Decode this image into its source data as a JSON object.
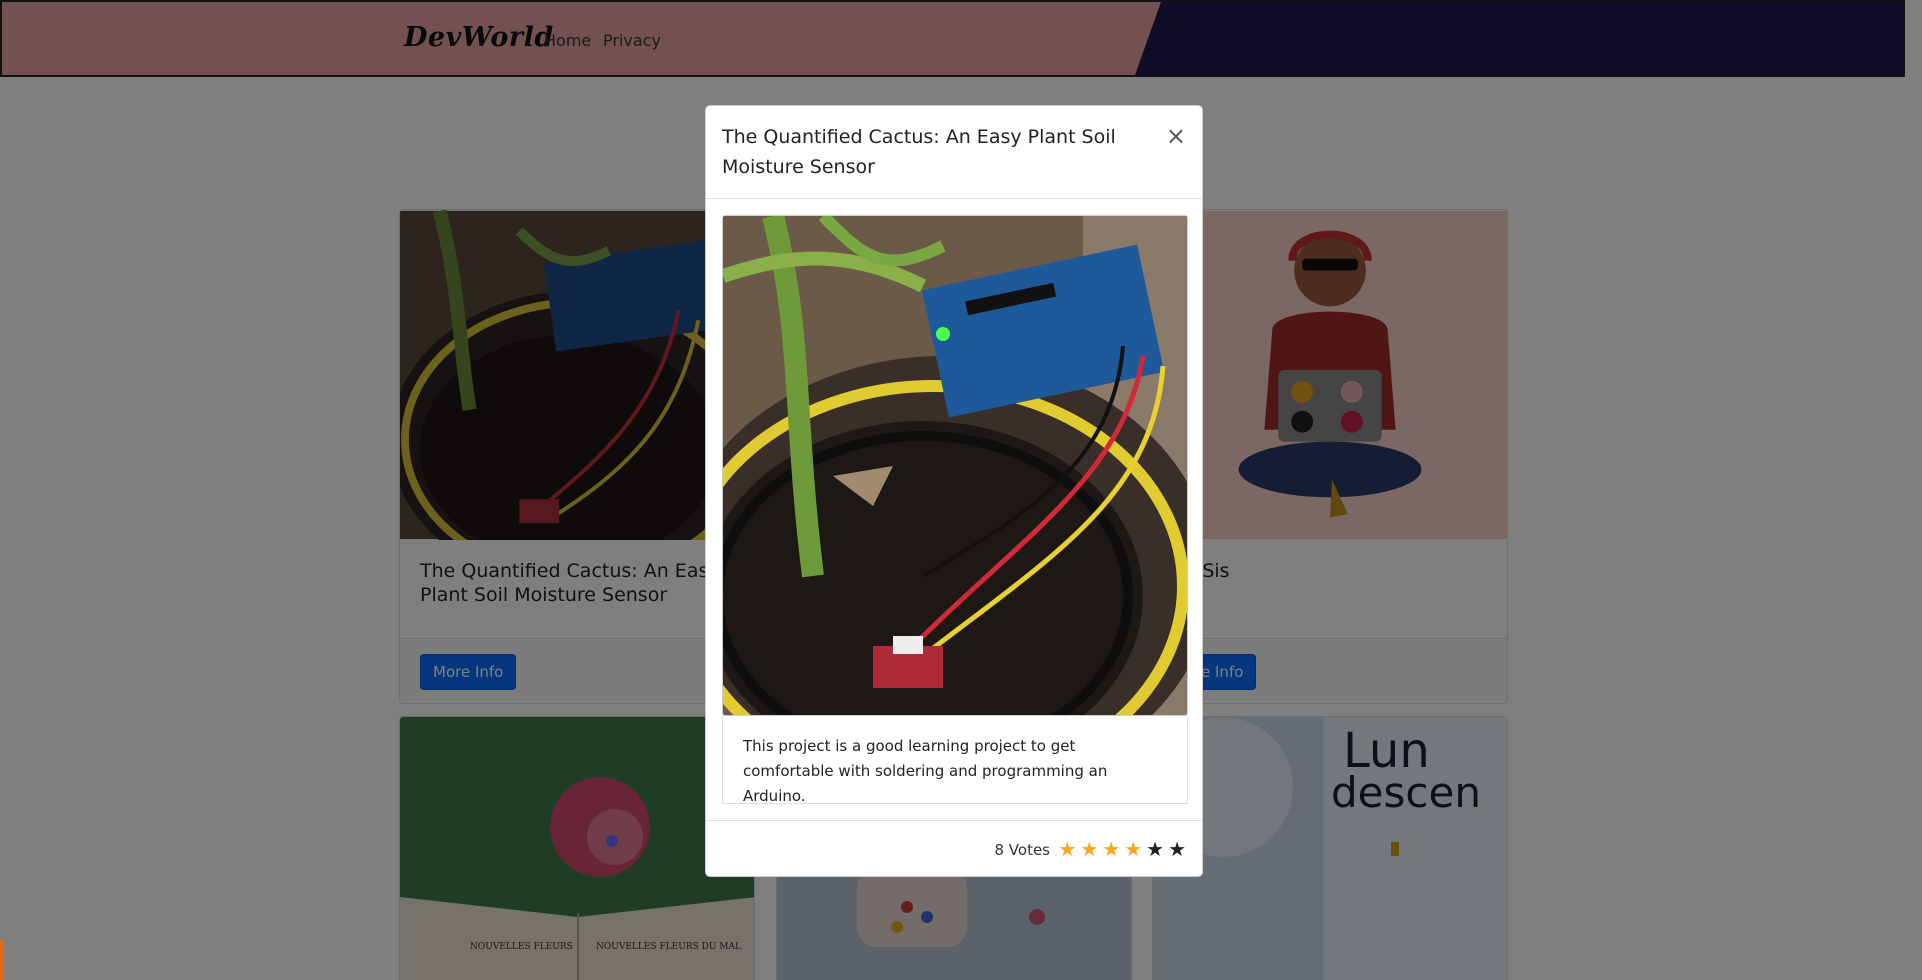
{
  "navbar": {
    "brand": "DevWorld",
    "links": [
      "Home",
      "Privacy"
    ]
  },
  "cards": [
    {
      "title": "The Quantified Cactus: An Easy Plant Soil Moisture Sensor",
      "button": "More Info"
    },
    {
      "title": "by Sis",
      "button": "ore Info"
    }
  ],
  "modal": {
    "title": "The Quantified Cactus: An Easy Plant Soil Moisture Sensor",
    "close": "×",
    "description": "This project is a good learning project to get comfortable with soldering and programming an Arduino.",
    "votes": "8 Votes",
    "rating": 4,
    "max_rating": 6
  },
  "background_card_images": {
    "top_right": "Lun",
    "top_right_line2": "descen",
    "book_left": "NOUVELLES FLEURS",
    "book_right": "NOUVELLES FLEURS DU MAL"
  },
  "colors": {
    "navbar_pink": "#e9a3a3",
    "navbar_navy": "#1c1a4a",
    "button_blue": "#0d6efd",
    "star_gold": "#f5a623"
  }
}
